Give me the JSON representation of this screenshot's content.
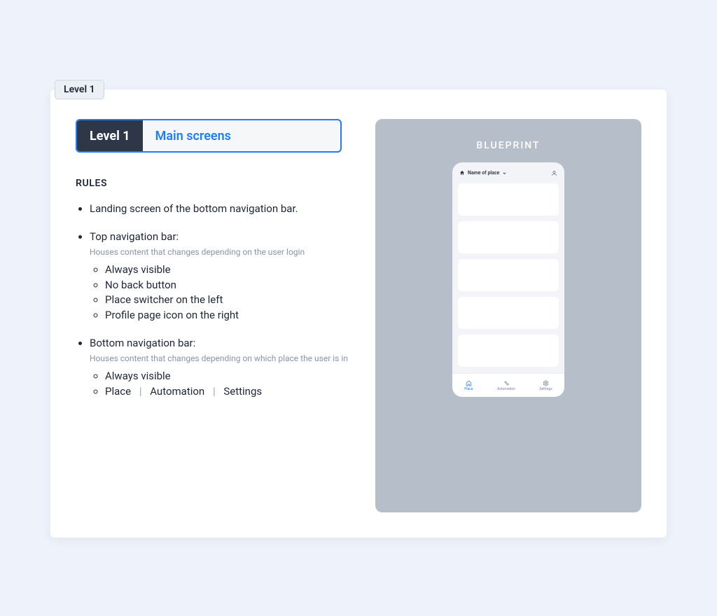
{
  "tag": "Level 1",
  "tabs": {
    "active": "Level 1",
    "secondary": "Main screens"
  },
  "rules_heading": "RULES",
  "rules": {
    "item1": "Landing screen of the bottom navigation bar.",
    "item2": {
      "title": "Top navigation bar:",
      "note": "Houses content that changes depending on the user login",
      "bullets": [
        "Always visible",
        "No back button",
        "Place switcher on the left",
        "Profile page icon on the right"
      ]
    },
    "item3": {
      "title": "Bottom navigation bar:",
      "note": "Houses content that changes depending on which place the user is in",
      "bullets_line1": "Always visible",
      "bullets_line2_parts": [
        "Place",
        "Automation",
        "Settings"
      ]
    }
  },
  "blueprint": {
    "title": "BLUEPRINT",
    "phone": {
      "place_label": "Name of place",
      "nav": {
        "place": "Place",
        "automation": "Automation",
        "settings": "Settings"
      }
    }
  }
}
